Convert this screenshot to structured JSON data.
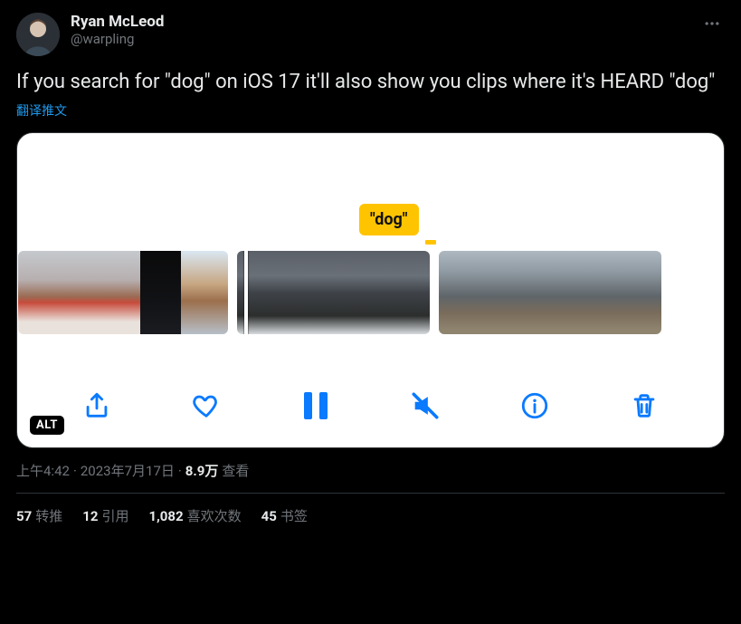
{
  "author": {
    "display_name": "Ryan McLeod",
    "handle": "@warpling"
  },
  "tweet_text": "If you search for \"dog\" on iOS 17 it'll also show you clips where it's HEARD \"dog\"",
  "translate_label": "翻译推文",
  "media": {
    "search_tag": "\"dog\"",
    "alt_badge": "ALT",
    "toolbar": {
      "share": "share",
      "like": "like",
      "pause": "pause",
      "mute": "mute",
      "info": "info",
      "delete": "delete"
    }
  },
  "meta": {
    "time": "上午4:42",
    "sep1": " · ",
    "date": "2023年7月17日",
    "sep2": " · ",
    "views_number": "8.9万",
    "views_label": " 查看"
  },
  "stats": {
    "retweets": {
      "count": "57",
      "label": "转推"
    },
    "quotes": {
      "count": "12",
      "label": "引用"
    },
    "likes": {
      "count": "1,082",
      "label": "喜欢次数"
    },
    "bookmarks": {
      "count": "45",
      "label": "书签"
    }
  }
}
